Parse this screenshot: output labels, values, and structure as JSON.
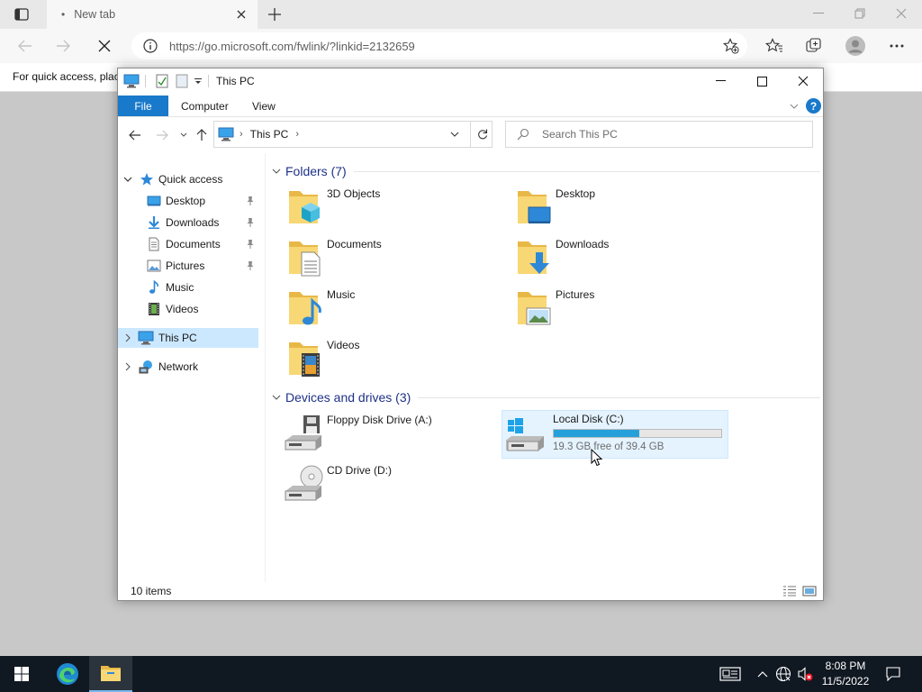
{
  "browser": {
    "tab_title": "New tab",
    "url": "https://go.microsoft.com/fwlink/?linkid=2132659",
    "infobar_text": "For quick access, plac"
  },
  "explorer": {
    "window_title": "This PC",
    "ribbon": {
      "file": "File",
      "computer": "Computer",
      "view": "View",
      "help": "?"
    },
    "breadcrumb": "This PC",
    "search_placeholder": "Search This PC",
    "nav": {
      "quick_access": "Quick access",
      "items": [
        "Desktop",
        "Downloads",
        "Documents",
        "Pictures",
        "Music",
        "Videos"
      ],
      "this_pc": "This PC",
      "network": "Network"
    },
    "folders_header": "Folders (7)",
    "folders": [
      "3D Objects",
      "Desktop",
      "Documents",
      "Downloads",
      "Music",
      "Pictures",
      "Videos"
    ],
    "devices_header": "Devices and drives (3)",
    "drives": {
      "floppy": "Floppy Disk Drive (A:)",
      "local": "Local Disk (C:)",
      "local_free": "19.3 GB free of 39.4 GB",
      "local_used_fraction": 0.51,
      "cd": "CD Drive (D:)"
    },
    "status": "10 items"
  },
  "taskbar": {
    "time": "8:08 PM",
    "date": "11/5/2022"
  },
  "colors": {
    "accent": "#1979ca",
    "selection": "#cce8ff",
    "bar_fill": "#26a0da",
    "group_title": "#1e3287",
    "taskbar": "#101821"
  }
}
